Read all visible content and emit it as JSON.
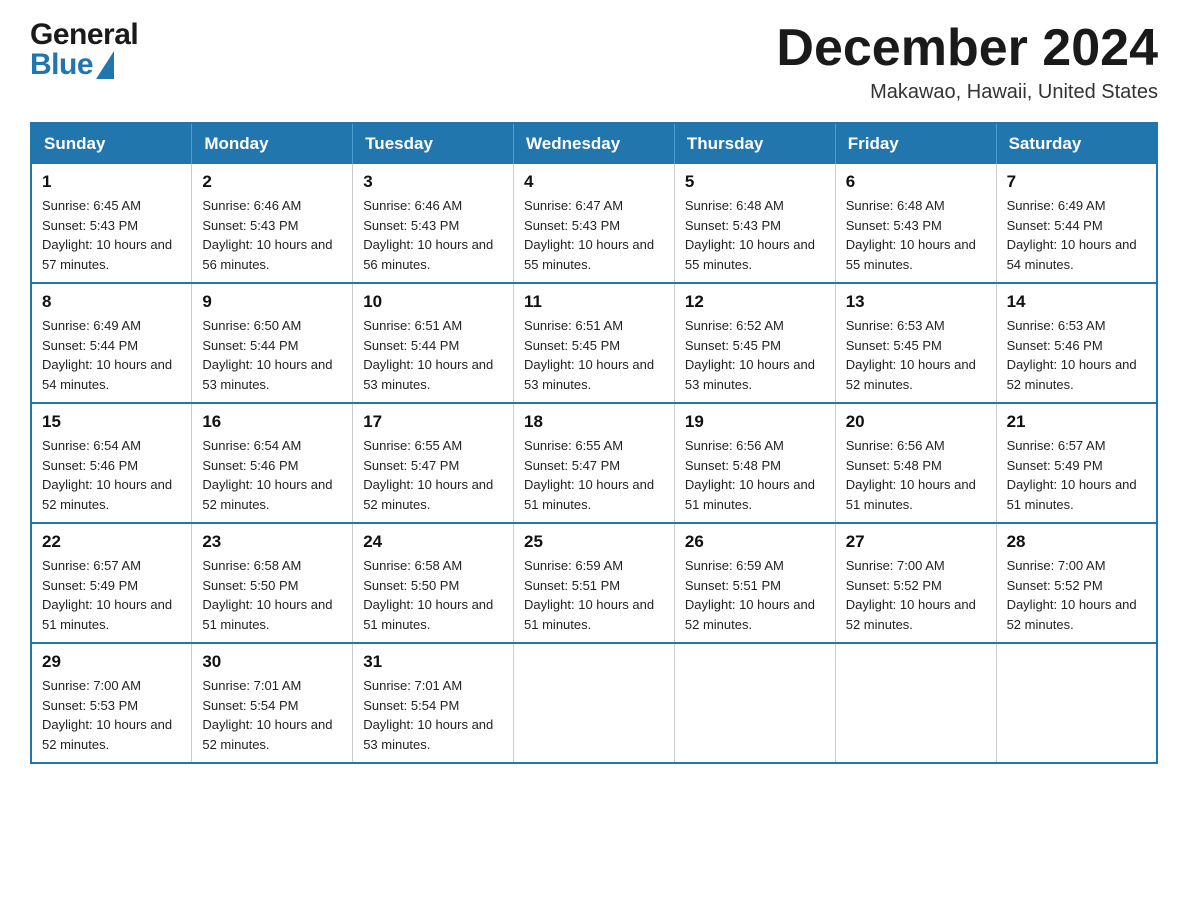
{
  "header": {
    "logo_general": "General",
    "logo_blue": "Blue",
    "month_title": "December 2024",
    "location": "Makawao, Hawaii, United States"
  },
  "days_of_week": [
    "Sunday",
    "Monday",
    "Tuesday",
    "Wednesday",
    "Thursday",
    "Friday",
    "Saturday"
  ],
  "weeks": [
    [
      {
        "day": "1",
        "sunrise": "6:45 AM",
        "sunset": "5:43 PM",
        "daylight": "10 hours and 57 minutes."
      },
      {
        "day": "2",
        "sunrise": "6:46 AM",
        "sunset": "5:43 PM",
        "daylight": "10 hours and 56 minutes."
      },
      {
        "day": "3",
        "sunrise": "6:46 AM",
        "sunset": "5:43 PM",
        "daylight": "10 hours and 56 minutes."
      },
      {
        "day": "4",
        "sunrise": "6:47 AM",
        "sunset": "5:43 PM",
        "daylight": "10 hours and 55 minutes."
      },
      {
        "day": "5",
        "sunrise": "6:48 AM",
        "sunset": "5:43 PM",
        "daylight": "10 hours and 55 minutes."
      },
      {
        "day": "6",
        "sunrise": "6:48 AM",
        "sunset": "5:43 PM",
        "daylight": "10 hours and 55 minutes."
      },
      {
        "day": "7",
        "sunrise": "6:49 AM",
        "sunset": "5:44 PM",
        "daylight": "10 hours and 54 minutes."
      }
    ],
    [
      {
        "day": "8",
        "sunrise": "6:49 AM",
        "sunset": "5:44 PM",
        "daylight": "10 hours and 54 minutes."
      },
      {
        "day": "9",
        "sunrise": "6:50 AM",
        "sunset": "5:44 PM",
        "daylight": "10 hours and 53 minutes."
      },
      {
        "day": "10",
        "sunrise": "6:51 AM",
        "sunset": "5:44 PM",
        "daylight": "10 hours and 53 minutes."
      },
      {
        "day": "11",
        "sunrise": "6:51 AM",
        "sunset": "5:45 PM",
        "daylight": "10 hours and 53 minutes."
      },
      {
        "day": "12",
        "sunrise": "6:52 AM",
        "sunset": "5:45 PM",
        "daylight": "10 hours and 53 minutes."
      },
      {
        "day": "13",
        "sunrise": "6:53 AM",
        "sunset": "5:45 PM",
        "daylight": "10 hours and 52 minutes."
      },
      {
        "day": "14",
        "sunrise": "6:53 AM",
        "sunset": "5:46 PM",
        "daylight": "10 hours and 52 minutes."
      }
    ],
    [
      {
        "day": "15",
        "sunrise": "6:54 AM",
        "sunset": "5:46 PM",
        "daylight": "10 hours and 52 minutes."
      },
      {
        "day": "16",
        "sunrise": "6:54 AM",
        "sunset": "5:46 PM",
        "daylight": "10 hours and 52 minutes."
      },
      {
        "day": "17",
        "sunrise": "6:55 AM",
        "sunset": "5:47 PM",
        "daylight": "10 hours and 52 minutes."
      },
      {
        "day": "18",
        "sunrise": "6:55 AM",
        "sunset": "5:47 PM",
        "daylight": "10 hours and 51 minutes."
      },
      {
        "day": "19",
        "sunrise": "6:56 AM",
        "sunset": "5:48 PM",
        "daylight": "10 hours and 51 minutes."
      },
      {
        "day": "20",
        "sunrise": "6:56 AM",
        "sunset": "5:48 PM",
        "daylight": "10 hours and 51 minutes."
      },
      {
        "day": "21",
        "sunrise": "6:57 AM",
        "sunset": "5:49 PM",
        "daylight": "10 hours and 51 minutes."
      }
    ],
    [
      {
        "day": "22",
        "sunrise": "6:57 AM",
        "sunset": "5:49 PM",
        "daylight": "10 hours and 51 minutes."
      },
      {
        "day": "23",
        "sunrise": "6:58 AM",
        "sunset": "5:50 PM",
        "daylight": "10 hours and 51 minutes."
      },
      {
        "day": "24",
        "sunrise": "6:58 AM",
        "sunset": "5:50 PM",
        "daylight": "10 hours and 51 minutes."
      },
      {
        "day": "25",
        "sunrise": "6:59 AM",
        "sunset": "5:51 PM",
        "daylight": "10 hours and 51 minutes."
      },
      {
        "day": "26",
        "sunrise": "6:59 AM",
        "sunset": "5:51 PM",
        "daylight": "10 hours and 52 minutes."
      },
      {
        "day": "27",
        "sunrise": "7:00 AM",
        "sunset": "5:52 PM",
        "daylight": "10 hours and 52 minutes."
      },
      {
        "day": "28",
        "sunrise": "7:00 AM",
        "sunset": "5:52 PM",
        "daylight": "10 hours and 52 minutes."
      }
    ],
    [
      {
        "day": "29",
        "sunrise": "7:00 AM",
        "sunset": "5:53 PM",
        "daylight": "10 hours and 52 minutes."
      },
      {
        "day": "30",
        "sunrise": "7:01 AM",
        "sunset": "5:54 PM",
        "daylight": "10 hours and 52 minutes."
      },
      {
        "day": "31",
        "sunrise": "7:01 AM",
        "sunset": "5:54 PM",
        "daylight": "10 hours and 53 minutes."
      },
      null,
      null,
      null,
      null
    ]
  ],
  "labels": {
    "sunrise_prefix": "Sunrise: ",
    "sunset_prefix": "Sunset: ",
    "daylight_prefix": "Daylight: "
  }
}
